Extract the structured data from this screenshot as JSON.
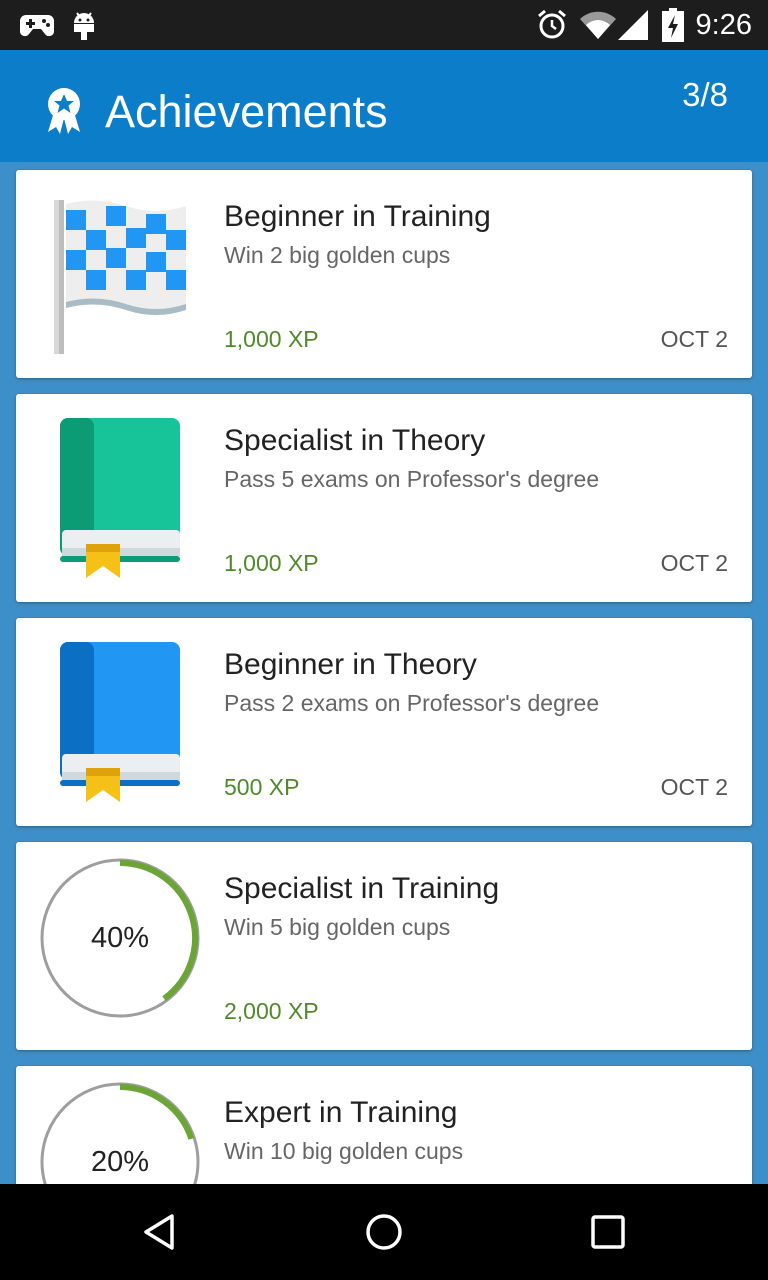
{
  "status_bar": {
    "time": "9:26",
    "left_icons": [
      "gamepad-icon",
      "android-icon"
    ],
    "right_icons": [
      "alarm-icon",
      "wifi-icon",
      "cell-signal-icon",
      "battery-charging-icon"
    ]
  },
  "app_bar": {
    "title": "Achievements",
    "count": "3/8",
    "progress_fraction": 0.375,
    "icon": "award-ribbon-icon",
    "accent": "#0c7dc8",
    "progress_color": "#6aa536"
  },
  "achievements": [
    {
      "name": "Beginner in Training",
      "description": "Win 2 big golden cups",
      "xp": "1,000 XP",
      "date": "OCT 2",
      "icon": "checkered-flag-icon"
    },
    {
      "name": "Specialist in Theory",
      "description": "Pass 5 exams on Professor's degree",
      "xp": "1,000 XP",
      "date": "OCT 2",
      "icon": "green-book-icon"
    },
    {
      "name": "Beginner in Theory",
      "description": "Pass 2 exams on Professor's degree",
      "xp": "500 XP",
      "date": "OCT 2",
      "icon": "blue-book-icon"
    },
    {
      "name": "Specialist in Training",
      "description": "Win 5 big golden cups",
      "xp": "2,000 XP",
      "progress": "40%",
      "progress_fraction": 0.4
    },
    {
      "name": "Expert in Training",
      "description": "Win 10 big golden cups",
      "progress": "20%",
      "progress_fraction": 0.2
    }
  ],
  "nav_bar": {
    "buttons": [
      "back-icon",
      "home-icon",
      "recents-icon"
    ]
  }
}
